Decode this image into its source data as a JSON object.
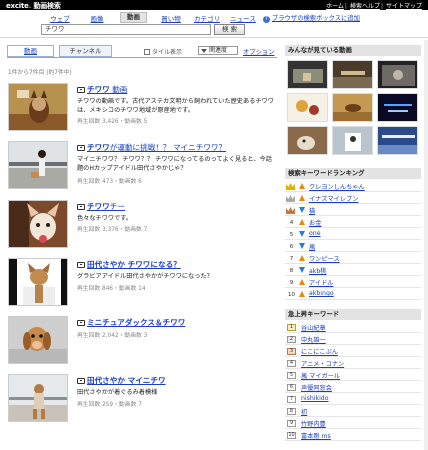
{
  "header": {
    "logo_brand": "excite",
    "logo_service": "動画検索",
    "links": [
      "ホーム",
      "検索ヘルプ",
      "サイトマップ"
    ]
  },
  "search": {
    "tabs": [
      "ウェブ",
      "画像",
      "動画",
      "買い物",
      "カテゴリ",
      "ニュース"
    ],
    "active_tab": "動画",
    "query": "チワワ",
    "button_label": "検 索",
    "tip": "ブラウザの検索ボックスに追加"
  },
  "modes": {
    "tabs": [
      "動画",
      "チャンネル"
    ],
    "active": "チャンネル",
    "tile_label": "タイル表示",
    "sort_label": "関連度",
    "options_label": "オプション"
  },
  "result_count": "1件から7件目 (約7件中)",
  "results": [
    {
      "title_hl": "チワワ",
      "title_rest": " 動画",
      "desc": "チワワの動画です。古代アステカ文明から飼われていた歴史あるチワワは、メキシコのチワワ地域が原産地です。",
      "meta": "再生回数 3,426・動画数 5"
    },
    {
      "title_hl": "チワワ",
      "title_rest": "が運動に挑戦！？ マイニチワワ？",
      "desc": "マイニチワワ？ チワワ？？ チワワになってるのってよく見ると、今話題のHカップアイドル田代さやかじゃ？",
      "meta": "再生回数 473・動画数 6"
    },
    {
      "title_hl": "チワワ",
      "title_rest": "チー",
      "desc": "色々なチワワです。",
      "meta": "再生回数 3,376・動画数 7"
    },
    {
      "title_hl": "田代さやか チワワになる？",
      "title_rest": "",
      "desc": "グラビアアイドル田代さやかがチワワになった？",
      "meta": "再生回数 846・動画数 14"
    },
    {
      "title_hl": "ミニチュアダックス＆チワワ",
      "title_rest": "",
      "desc": "",
      "meta": "再生回数 2,042・動画数 3"
    },
    {
      "title_hl": "田代さやか マイニチワ",
      "title_rest": "",
      "desc": "田代さやかが着ぐるみ着模様",
      "meta": "再生回数 259・動画数 7"
    }
  ],
  "sidebar": {
    "popular_title": "みんなが見ている動画",
    "ranking_title": "検索キーワードランキング",
    "ranking": [
      {
        "rank": "1",
        "trend": "up",
        "word": "クレヨンしんちゃん"
      },
      {
        "rank": "2",
        "trend": "up",
        "word": "イナズマイレブン"
      },
      {
        "rank": "3",
        "trend": "down",
        "word": "猫"
      },
      {
        "rank": "4",
        "trend": "up",
        "word": "お金"
      },
      {
        "rank": "5",
        "trend": "down",
        "word": "one"
      },
      {
        "rank": "6",
        "trend": "down",
        "word": "嵐"
      },
      {
        "rank": "7",
        "trend": "up",
        "word": "ワンピース"
      },
      {
        "rank": "8",
        "trend": "down",
        "word": "akb桃"
      },
      {
        "rank": "9",
        "trend": "up",
        "word": "アイドル"
      },
      {
        "rank": "10",
        "trend": "up",
        "word": "akbingo"
      }
    ],
    "rising_title": "急上昇キーワード",
    "rising": [
      {
        "rank": "1",
        "word": "谷山紀章"
      },
      {
        "rank": "2",
        "word": "中丸雄一"
      },
      {
        "rank": "3",
        "word": "にこにこぷん"
      },
      {
        "rank": "4",
        "word": "アニメ・コナン"
      },
      {
        "rank": "5",
        "word": "嵐 マイガール"
      },
      {
        "rank": "6",
        "word": "声優同窓会"
      },
      {
        "rank": "7",
        "word": "nishikido"
      },
      {
        "rank": "8",
        "word": "初"
      },
      {
        "rank": "9",
        "word": "竹野内豊"
      },
      {
        "rank": "10",
        "word": "富本剛 ms"
      }
    ]
  },
  "colors": {
    "link": "#1a3fbf",
    "header_bg": "#000000",
    "panel_header": "#e3e3e3",
    "accent_orange": "#f39800"
  }
}
